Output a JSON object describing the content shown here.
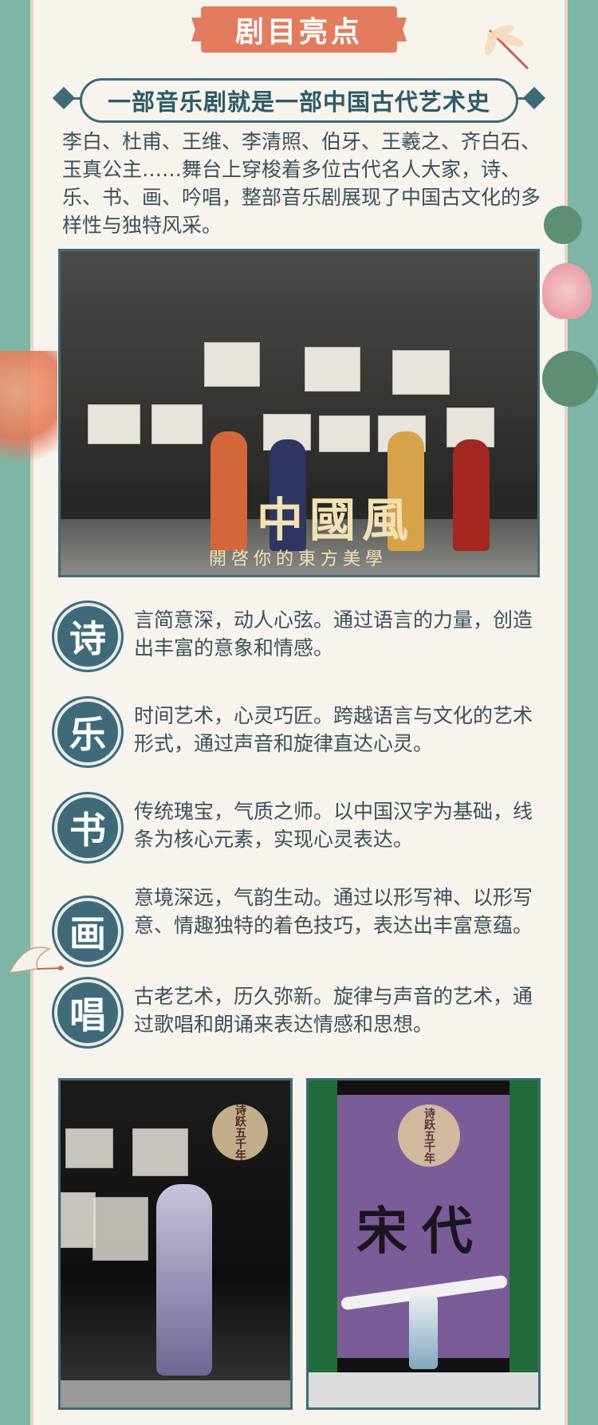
{
  "header": {
    "title": "剧目亮点"
  },
  "subtitle": "一部音乐剧就是一部中国古代艺术史",
  "intro": "李白、杜甫、王维、李清照、伯牙、王羲之、齐白石、玉真公主……舞台上穿梭着多位古代名人大家，诗、乐、书、画、吟唱，整部音乐剧展现了中国古文化的多样性与独特风采。",
  "main_photo": {
    "logo_title": "中國風",
    "logo_subtitle": "開啓你的東方美學"
  },
  "arts": [
    {
      "char": "诗",
      "text": "言简意深，动人心弦。通过语言的力量，创造出丰富的意象和情感。"
    },
    {
      "char": "乐",
      "text": "时间艺术，心灵巧匠。跨越语言与文化的艺术形式，通过声音和旋律直达心灵。"
    },
    {
      "char": "书",
      "text": "传统瑰宝，气质之师。以中国汉字为基础，线条为核心元素，实现心灵表达。"
    },
    {
      "char": "画",
      "text": "意境深远，气韵生动。通过以形写神、以形写意、情趣独特的着色技巧，表达出丰富意蕴。"
    },
    {
      "char": "唱",
      "text": "古老艺术，历久弥新。旋律与声音的艺术，通过歌唱和朗诵来表达情感和思想。"
    }
  ],
  "bottom_photos": {
    "left_seal": "诗跃五千年",
    "right_seal": "诗跃五千年",
    "right_title": "宋代"
  }
}
